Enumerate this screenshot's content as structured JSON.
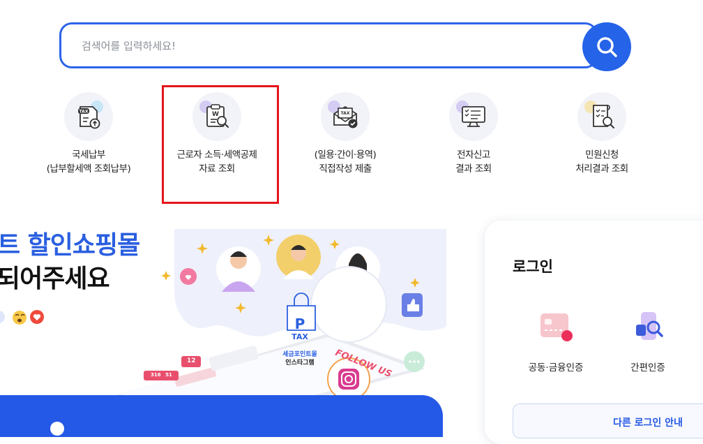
{
  "search": {
    "placeholder": "검색어를 입력하세요!"
  },
  "quick_menu": [
    {
      "line1": "국세납부",
      "line2": "(납부할세액 조회납부)",
      "icon": "tax-payment-icon"
    },
    {
      "line1": "근로자 소득·세액공제",
      "line2": "자료 조회",
      "icon": "deduction-lookup-icon"
    },
    {
      "line1": "(일용·간이·용역)",
      "line2": "직접작성 제출",
      "icon": "tax-mail-icon"
    },
    {
      "line1": "전자신고",
      "line2": "결과 조회",
      "icon": "e-filing-result-icon"
    },
    {
      "line1": "민원신청",
      "line2": "처리결과 조회",
      "icon": "civil-request-icon"
    }
  ],
  "banner": {
    "title_line1": "트 할인쇼핑몰",
    "title_line2": "되어주세요",
    "badge_text_top": "TAX",
    "badge_letter": "P",
    "badge_caption1": "세금포인트몰",
    "badge_caption2": "인스타그램",
    "follow_text": "FOLLOW US",
    "counter_followers": "12",
    "counter_stats": "316",
    "counter_comments": "51"
  },
  "login": {
    "title": "로그인",
    "options": [
      {
        "label": "공동·금융인증",
        "icon": "certificate-card-icon"
      },
      {
        "label": "간편인증",
        "icon": "simple-auth-icon"
      }
    ],
    "guide_label": "다른 로그인 안내"
  },
  "colors": {
    "accent": "#2563e8",
    "highlight": "#e5141b"
  }
}
